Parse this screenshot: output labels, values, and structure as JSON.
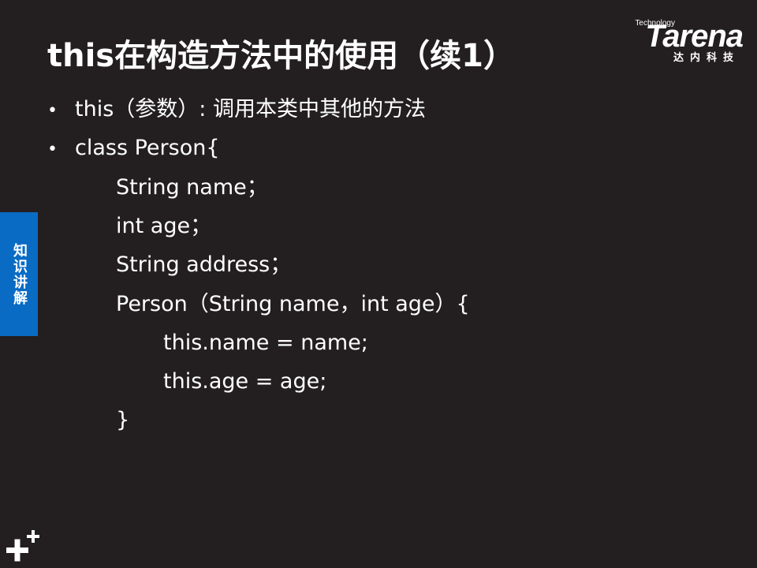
{
  "slide": {
    "title": "this在构造方法中的使用（续1）"
  },
  "logo": {
    "tagline": "Technology",
    "wordmark": "Tarena",
    "chinese": "达内科技"
  },
  "side_tab": {
    "label": "知识讲解"
  },
  "bullets": [
    {
      "text": "this（参数）: 调用本类中其他的方法"
    },
    {
      "text": "class  Person{"
    }
  ],
  "code_lines": [
    {
      "text": "String name；"
    },
    {
      "text": "int age；"
    },
    {
      "text": "String  address；"
    },
    {
      "text": "Person（String name，int age）{"
    },
    {
      "text": "this.name = name;"
    },
    {
      "text": "this.age = age;"
    },
    {
      "text": "}"
    }
  ],
  "icons": {
    "corner": "plus-icon"
  },
  "colors": {
    "background": "#231f20",
    "accent": "#0a6bc4",
    "text": "#ffffff"
  }
}
